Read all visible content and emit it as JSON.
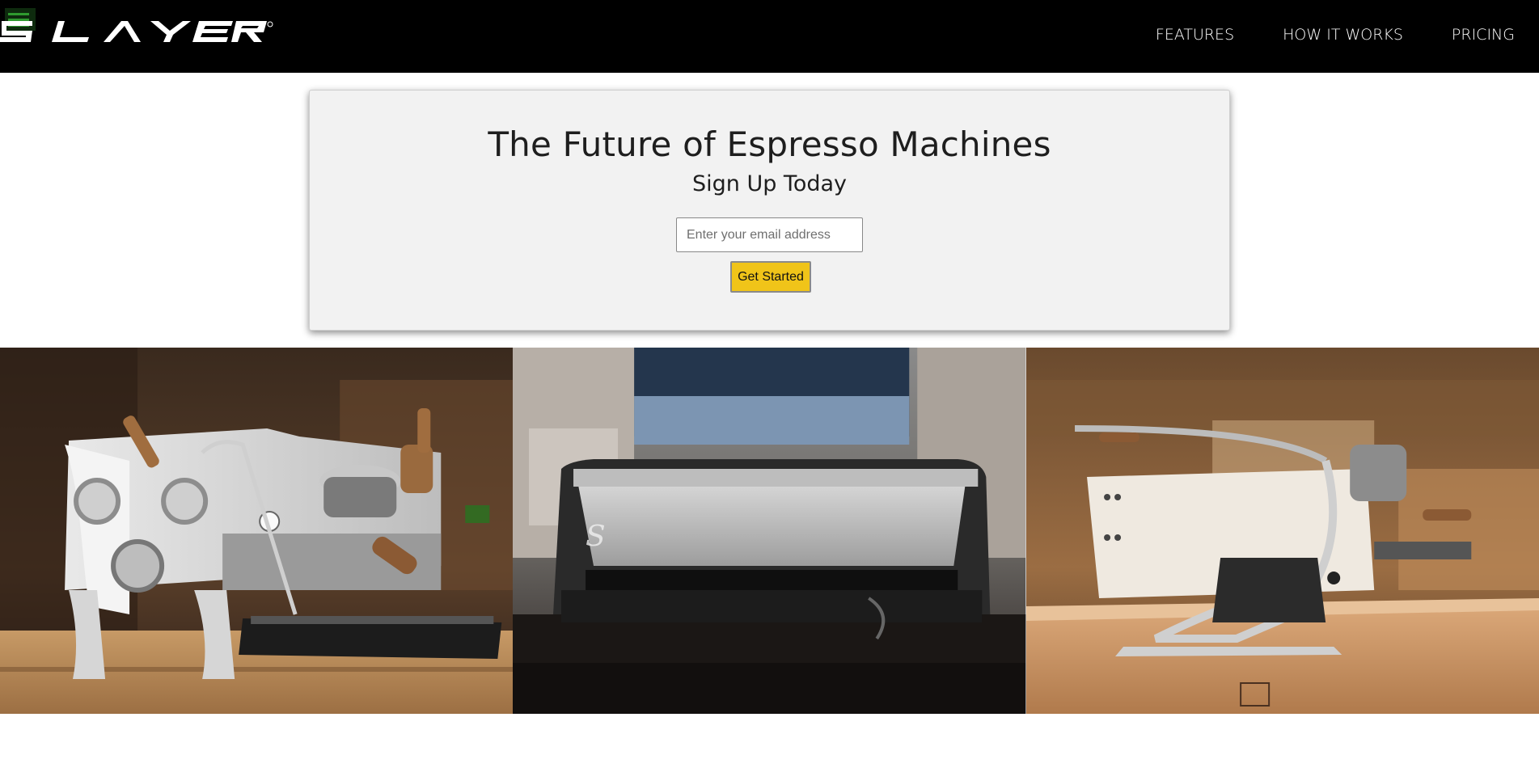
{
  "header": {
    "logo_text": "SLAYER",
    "nav": [
      {
        "label": "FEATURES"
      },
      {
        "label": "HOW IT WORKS"
      },
      {
        "label": "PRICING"
      }
    ]
  },
  "hero": {
    "title": "The Future of Espresso Machines",
    "subtitle": "Sign Up Today",
    "email_placeholder": "Enter your email address",
    "cta_label": "Get Started"
  },
  "photos": [
    {
      "icon": "espresso-machine-white-photo"
    },
    {
      "icon": "espresso-machine-front-photo"
    },
    {
      "icon": "espresso-machine-side-photo"
    }
  ],
  "colors": {
    "header_bg": "#000000",
    "cta_bg": "#f0c419",
    "card_bg": "#f2f2f2"
  }
}
